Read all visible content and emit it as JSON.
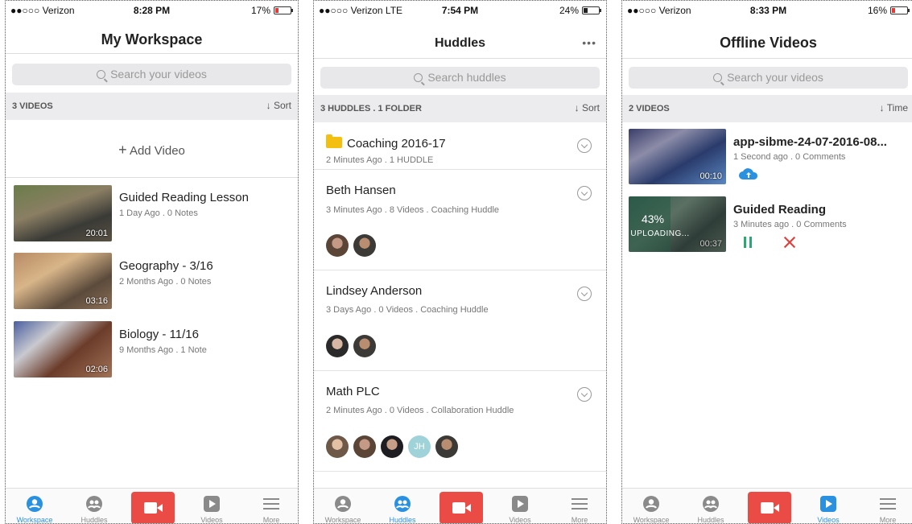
{
  "screen1": {
    "status": {
      "carrier": "●●○○○ Verizon",
      "time": "8:28 PM",
      "battery": "17%"
    },
    "title": "My Workspace",
    "search_placeholder": "Search your videos",
    "count_label": "3 VIDEOS",
    "sort_label": "Sort",
    "add_video_label": "Add Video",
    "videos": [
      {
        "title": "Guided Reading Lesson",
        "meta": "1 Day Ago . 0 Notes",
        "duration": "20:01"
      },
      {
        "title": "Geography - 3/16",
        "meta": "2 Months Ago . 0 Notes",
        "duration": "03:16"
      },
      {
        "title": "Biology - 11/16",
        "meta": "9 Months Ago . 1 Note",
        "duration": "02:06"
      }
    ],
    "active_tab": "Workspace"
  },
  "screen2": {
    "status": {
      "carrier": "●●○○○ Verizon  LTE",
      "time": "7:54 PM",
      "battery": "24%"
    },
    "title": "Huddles",
    "more_label": "•••",
    "search_placeholder": "Search huddles",
    "count_label": "3 HUDDLES . 1 FOLDER",
    "sort_label": "Sort",
    "folder": {
      "name": "Coaching 2016-17",
      "meta": "2 Minutes Ago . 1 HUDDLE"
    },
    "huddles": [
      {
        "name": "Beth Hansen",
        "meta": "3 Minutes Ago . 8 Videos . Coaching Huddle"
      },
      {
        "name": "Lindsey Anderson",
        "meta": "3 Days Ago . 0 Videos . Coaching Huddle"
      },
      {
        "name": "Math PLC",
        "meta": "2 Minutes Ago . 0 Videos . Collaboration Huddle",
        "initials": "JH"
      }
    ],
    "active_tab": "Huddles"
  },
  "screen3": {
    "status": {
      "carrier": "●●○○○ Verizon",
      "time": "8:33 PM",
      "battery": "16%"
    },
    "title": "Offline Videos",
    "search_placeholder": "Search your videos",
    "count_label": "2 VIDEOS",
    "sort_label": "Time",
    "videos": [
      {
        "title": "app-sibme-24-07-2016-08...",
        "meta": "1 Second ago . 0 Comments",
        "duration": "00:10"
      },
      {
        "title": "Guided Reading",
        "meta": "3 Minutes ago . 0 Comments",
        "duration": "00:37",
        "upload_percent": "43%",
        "upload_label": "UPLOADING..."
      }
    ],
    "active_tab": "Videos"
  },
  "tabs": [
    "Workspace",
    "Huddles",
    "Videos",
    "More"
  ],
  "colors": {
    "accent": "#2a91e0",
    "record": "#ea4b45",
    "pause": "#29a872",
    "cancel": "#e53935"
  }
}
